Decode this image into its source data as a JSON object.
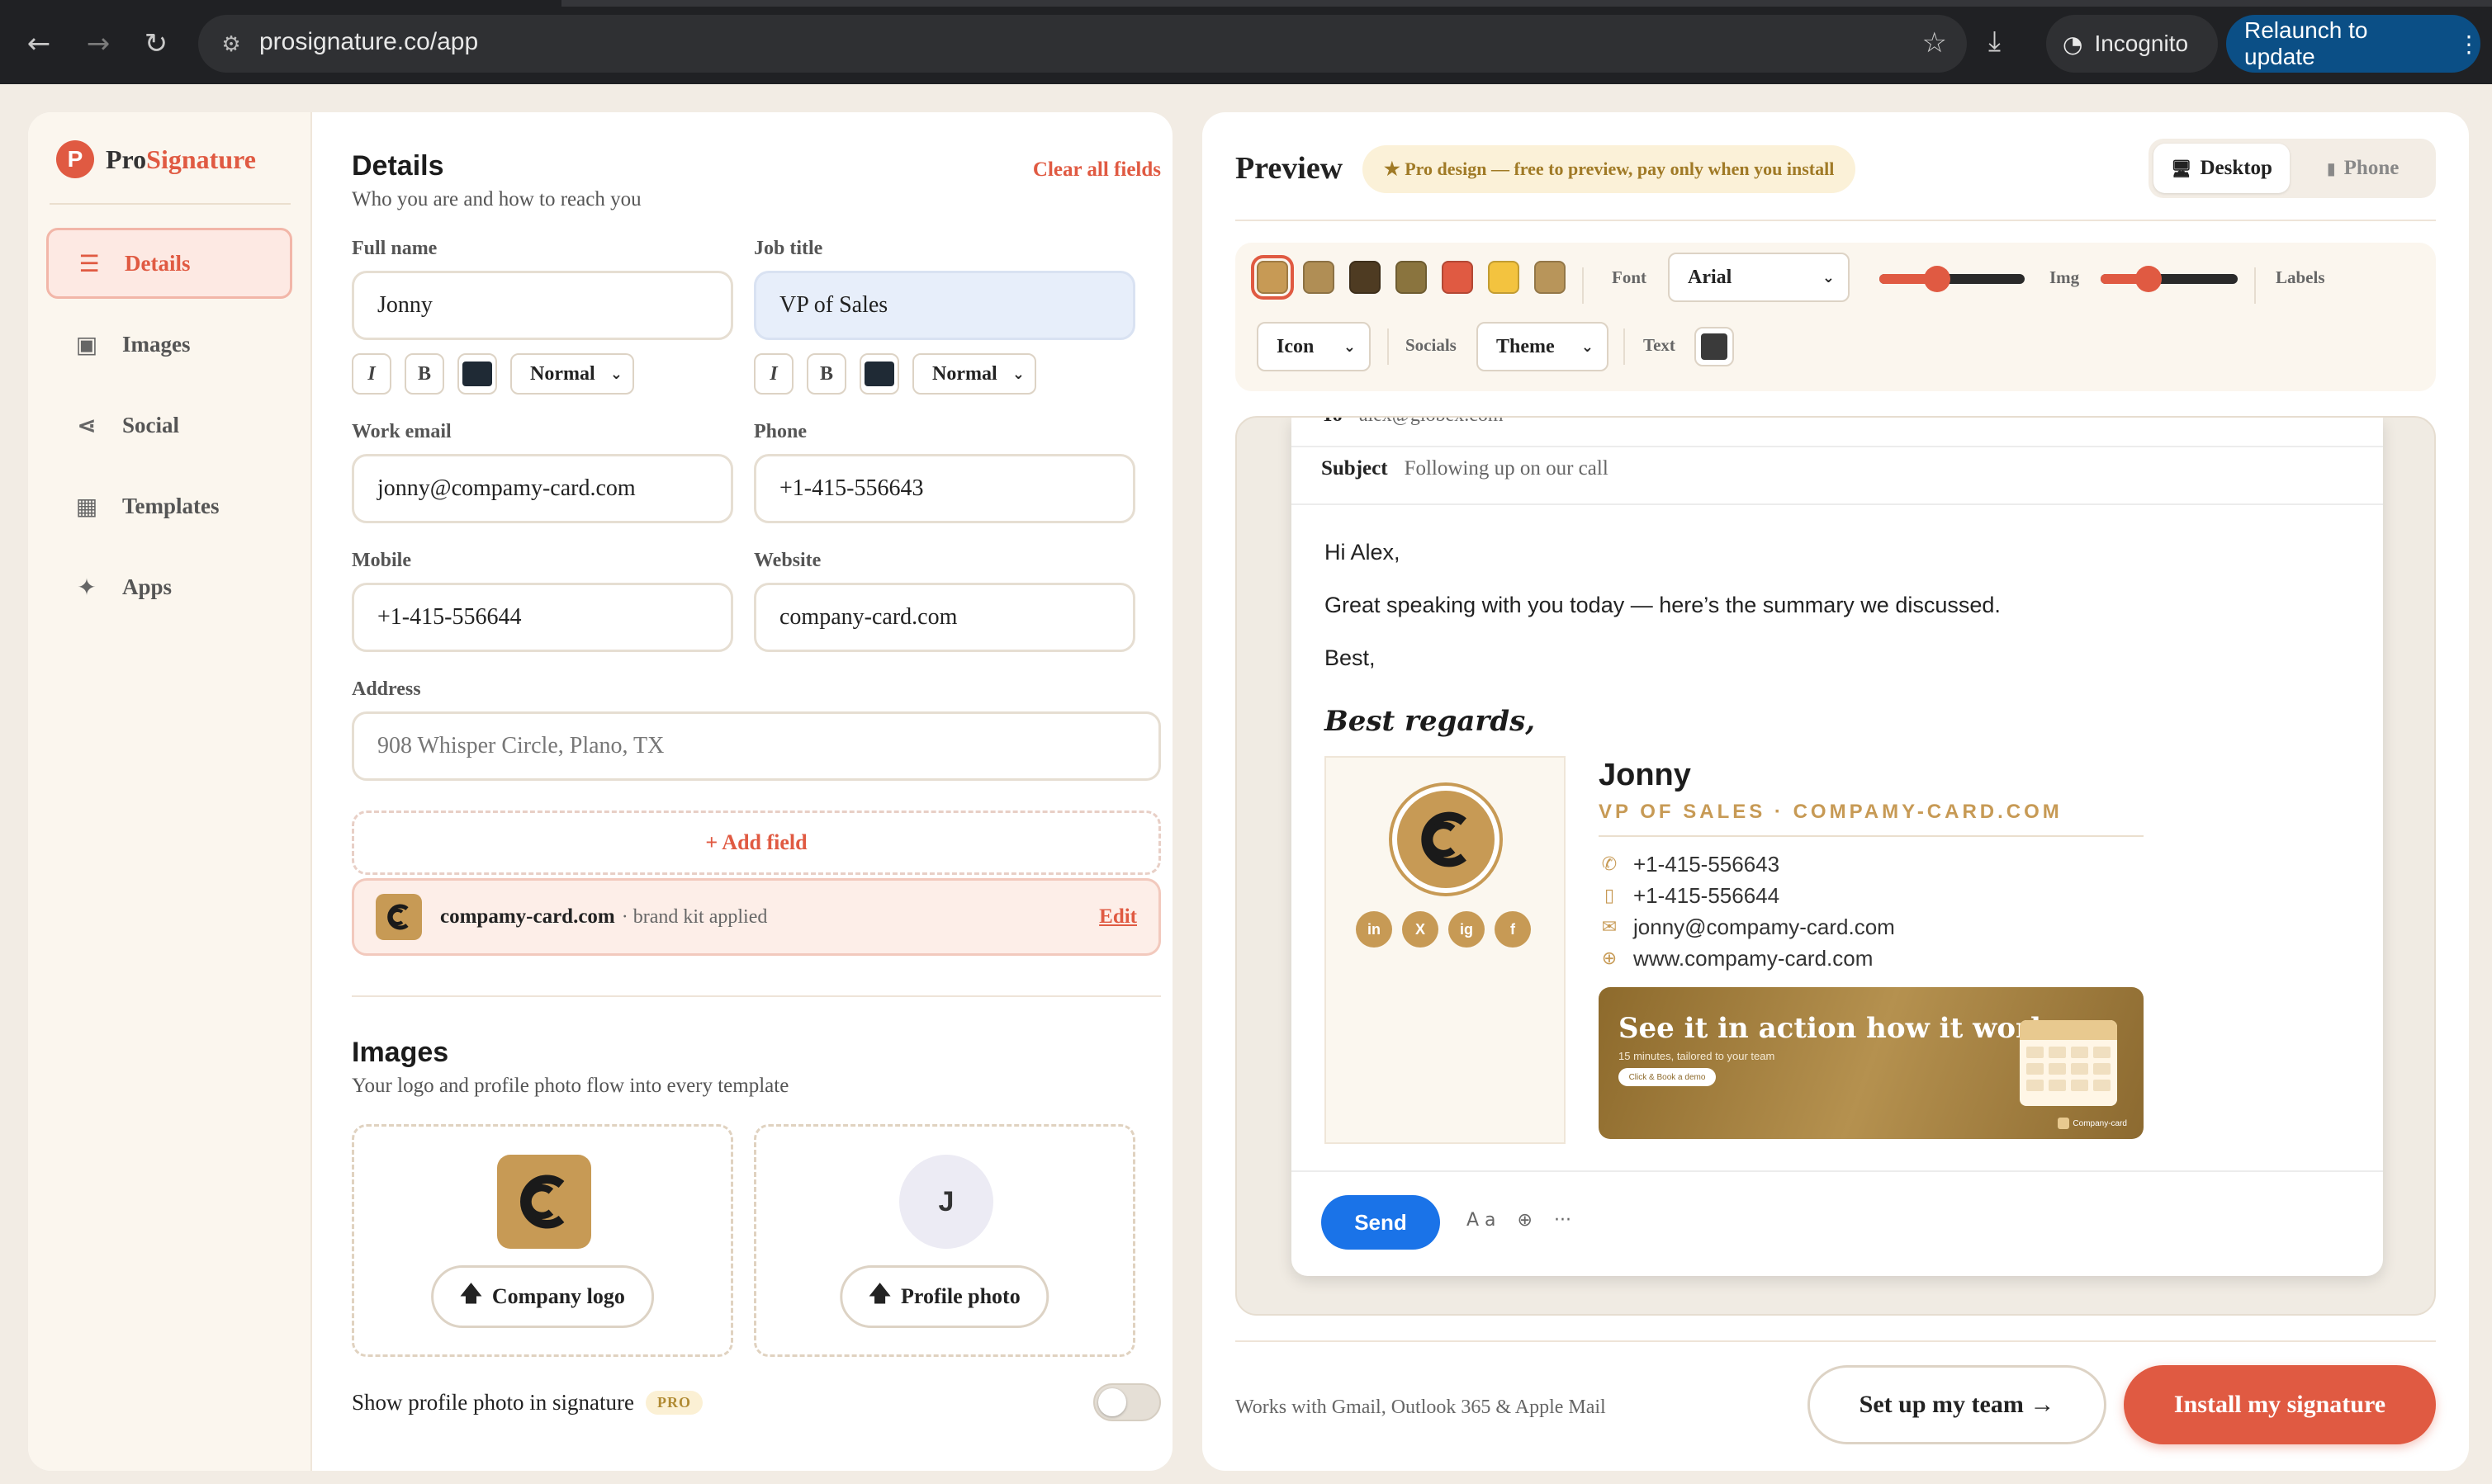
{
  "browser": {
    "url": "prosignature.co/app",
    "incognito_label": "Incognito",
    "relaunch_label": "Relaunch to update",
    "back_icon": "back-arrow-icon",
    "forward_icon": "forward-arrow-icon",
    "reload_icon": "reload-icon"
  },
  "brand": {
    "pro": "Pro",
    "signature": "Signature",
    "logo_letter": "P"
  },
  "sidebar": {
    "items": [
      {
        "label": "Details",
        "icon": "list-icon",
        "active": true
      },
      {
        "label": "Images",
        "icon": "image-icon"
      },
      {
        "label": "Social",
        "icon": "share-icon"
      },
      {
        "label": "Templates",
        "icon": "grid-icon"
      },
      {
        "label": "Apps",
        "icon": "sparkle-icon"
      }
    ]
  },
  "details": {
    "title": "Details",
    "subtitle": "Who you are and how to reach you",
    "clear_all": "Clear all fields",
    "full_name": {
      "label": "Full name",
      "value": "Jonny"
    },
    "job_title": {
      "label": "Job title",
      "value": "VP of Sales"
    },
    "format": {
      "italic": "I",
      "bold": "B",
      "weight": "Normal"
    },
    "work_email": {
      "label": "Work email",
      "value": "jonny@compamy-card.com"
    },
    "phone": {
      "label": "Phone",
      "value": "+1-415-556643"
    },
    "mobile": {
      "label": "Mobile",
      "value": "+1-415-556644"
    },
    "website": {
      "label": "Website",
      "value": "company-card.com"
    },
    "address": {
      "label": "Address",
      "value": "908 Whisper Circle, Plano, TX"
    },
    "add_field": "+ Add field",
    "brand_kit": {
      "domain": "compamy-card.com",
      "note": "· brand kit applied",
      "edit": "Edit"
    }
  },
  "images": {
    "title": "Images",
    "subtitle": "Your logo and profile photo flow into every template",
    "company_logo_btn": "Company logo",
    "profile_photo_btn": "Profile photo",
    "avatar_initial": "J",
    "show_photo_label": "Show profile photo in signature",
    "pro_badge": "PRO",
    "show_photo_enabled": false
  },
  "preview": {
    "title": "Preview",
    "banner": "★ Pro design — free to preview, pay only when you install",
    "desktop": "Desktop",
    "phone": "Phone",
    "toolbar": {
      "swatches": [
        "#c79a55",
        "#b08e55",
        "#4e3b22",
        "#8a743e",
        "#e05a42",
        "#f3c33f",
        "#b8955a"
      ],
      "font_label": "Font",
      "font_value": "Arial",
      "img_label": "Img",
      "labels_label": "Labels",
      "icon_value": "Icon",
      "socials_label": "Socials",
      "theme_value": "Theme",
      "text_label": "Text",
      "font_size_level": 0.4,
      "img_size_level": 0.35
    },
    "email": {
      "to_label": "To",
      "to_value": "alex@globex.com",
      "subject_label": "Subject",
      "subject_value": "Following up on our call",
      "greeting": "Hi Alex,",
      "body": "Great speaking with you today — here’s the summary we discussed.",
      "closing": "Best,",
      "send": "Send",
      "format_tool": "A a",
      "attach_tool": "⊕",
      "more_tool": "···"
    },
    "signature": {
      "regards": "Best regards,",
      "name": "Jonny",
      "title_line": "VP OF SALES · COMPAMY-CARD.COM",
      "phone": "+1-415-556643",
      "mobile": "+1-415-556644",
      "email": "jonny@compamy-card.com",
      "website": "www.compamy-card.com",
      "socials": [
        "in",
        "X",
        "ig",
        "f"
      ],
      "banner_title": "See it in action how it works",
      "banner_sub": "15 minutes, tailored to your team",
      "banner_btn": "Click & Book a demo",
      "banner_brand": "Company-card"
    },
    "footnote": "Works with Gmail, Outlook 365 & Apple Mail",
    "team_btn": "Set up my team →",
    "install_btn": "Install my signature"
  }
}
